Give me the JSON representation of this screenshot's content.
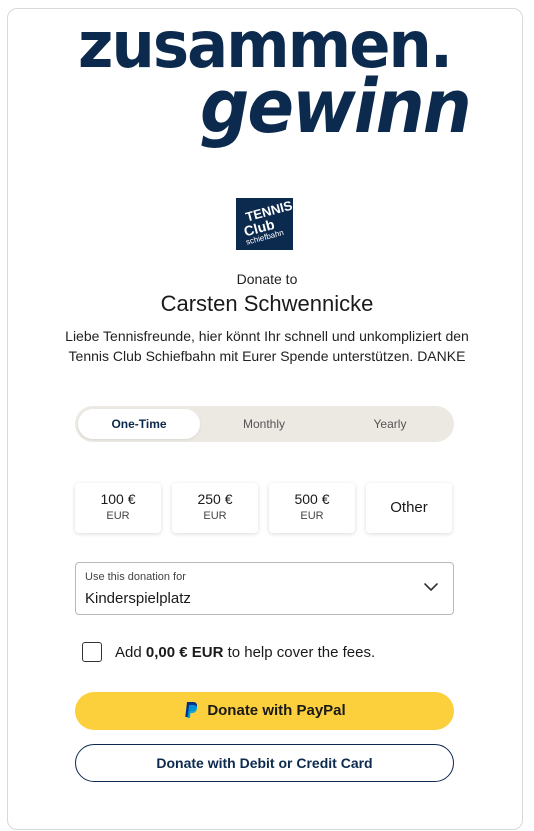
{
  "banner": {
    "line1": "zusammen.",
    "line2": "gewinn"
  },
  "org_logo": {
    "line1": "TENNIS",
    "line2": "Club",
    "line3": "schiefbahn"
  },
  "donate_to_label": "Donate to",
  "recipient_name": "Carsten Schwennicke",
  "description": "Liebe Tennisfreunde, hier könnt Ihr schnell und unkompliziert den Tennis Club Schiefbahn mit Eurer Spende unterstützen. DANKE",
  "frequency": {
    "tabs": [
      "One-Time",
      "Monthly",
      "Yearly"
    ],
    "selected": "One-Time"
  },
  "amounts": [
    {
      "value": "100 €",
      "currency": "EUR"
    },
    {
      "value": "250 €",
      "currency": "EUR"
    },
    {
      "value": "500 €",
      "currency": "EUR"
    }
  ],
  "other_label": "Other",
  "purpose": {
    "label": "Use this donation for",
    "value": "Kinderspielplatz"
  },
  "fees": {
    "prefix": "Add ",
    "amount": "0,00 € EUR",
    "suffix": " to help cover the fees.",
    "checked": false
  },
  "paypal_button": "Donate with PayPal",
  "card_button": "Donate with Debit or Credit Card",
  "colors": {
    "brand_navy": "#0c2a4e",
    "paypal_yellow": "#fcd03c",
    "toggle_bg": "#ece9e3"
  }
}
